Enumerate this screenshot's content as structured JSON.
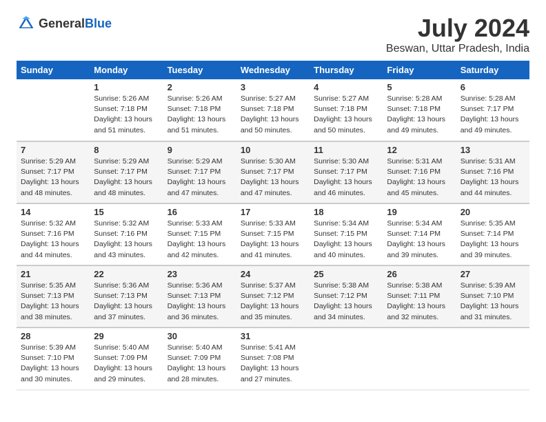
{
  "header": {
    "logo_general": "General",
    "logo_blue": "Blue",
    "title": "July 2024",
    "subtitle": "Beswan, Uttar Pradesh, India"
  },
  "columns": [
    "Sunday",
    "Monday",
    "Tuesday",
    "Wednesday",
    "Thursday",
    "Friday",
    "Saturday"
  ],
  "weeks": [
    {
      "days": [
        {
          "number": "",
          "lines": []
        },
        {
          "number": "1",
          "lines": [
            "Sunrise: 5:26 AM",
            "Sunset: 7:18 PM",
            "Daylight: 13 hours",
            "and 51 minutes."
          ]
        },
        {
          "number": "2",
          "lines": [
            "Sunrise: 5:26 AM",
            "Sunset: 7:18 PM",
            "Daylight: 13 hours",
            "and 51 minutes."
          ]
        },
        {
          "number": "3",
          "lines": [
            "Sunrise: 5:27 AM",
            "Sunset: 7:18 PM",
            "Daylight: 13 hours",
            "and 50 minutes."
          ]
        },
        {
          "number": "4",
          "lines": [
            "Sunrise: 5:27 AM",
            "Sunset: 7:18 PM",
            "Daylight: 13 hours",
            "and 50 minutes."
          ]
        },
        {
          "number": "5",
          "lines": [
            "Sunrise: 5:28 AM",
            "Sunset: 7:18 PM",
            "Daylight: 13 hours",
            "and 49 minutes."
          ]
        },
        {
          "number": "6",
          "lines": [
            "Sunrise: 5:28 AM",
            "Sunset: 7:17 PM",
            "Daylight: 13 hours",
            "and 49 minutes."
          ]
        }
      ]
    },
    {
      "days": [
        {
          "number": "7",
          "lines": [
            "Sunrise: 5:29 AM",
            "Sunset: 7:17 PM",
            "Daylight: 13 hours",
            "and 48 minutes."
          ]
        },
        {
          "number": "8",
          "lines": [
            "Sunrise: 5:29 AM",
            "Sunset: 7:17 PM",
            "Daylight: 13 hours",
            "and 48 minutes."
          ]
        },
        {
          "number": "9",
          "lines": [
            "Sunrise: 5:29 AM",
            "Sunset: 7:17 PM",
            "Daylight: 13 hours",
            "and 47 minutes."
          ]
        },
        {
          "number": "10",
          "lines": [
            "Sunrise: 5:30 AM",
            "Sunset: 7:17 PM",
            "Daylight: 13 hours",
            "and 47 minutes."
          ]
        },
        {
          "number": "11",
          "lines": [
            "Sunrise: 5:30 AM",
            "Sunset: 7:17 PM",
            "Daylight: 13 hours",
            "and 46 minutes."
          ]
        },
        {
          "number": "12",
          "lines": [
            "Sunrise: 5:31 AM",
            "Sunset: 7:16 PM",
            "Daylight: 13 hours",
            "and 45 minutes."
          ]
        },
        {
          "number": "13",
          "lines": [
            "Sunrise: 5:31 AM",
            "Sunset: 7:16 PM",
            "Daylight: 13 hours",
            "and 44 minutes."
          ]
        }
      ]
    },
    {
      "days": [
        {
          "number": "14",
          "lines": [
            "Sunrise: 5:32 AM",
            "Sunset: 7:16 PM",
            "Daylight: 13 hours",
            "and 44 minutes."
          ]
        },
        {
          "number": "15",
          "lines": [
            "Sunrise: 5:32 AM",
            "Sunset: 7:16 PM",
            "Daylight: 13 hours",
            "and 43 minutes."
          ]
        },
        {
          "number": "16",
          "lines": [
            "Sunrise: 5:33 AM",
            "Sunset: 7:15 PM",
            "Daylight: 13 hours",
            "and 42 minutes."
          ]
        },
        {
          "number": "17",
          "lines": [
            "Sunrise: 5:33 AM",
            "Sunset: 7:15 PM",
            "Daylight: 13 hours",
            "and 41 minutes."
          ]
        },
        {
          "number": "18",
          "lines": [
            "Sunrise: 5:34 AM",
            "Sunset: 7:15 PM",
            "Daylight: 13 hours",
            "and 40 minutes."
          ]
        },
        {
          "number": "19",
          "lines": [
            "Sunrise: 5:34 AM",
            "Sunset: 7:14 PM",
            "Daylight: 13 hours",
            "and 39 minutes."
          ]
        },
        {
          "number": "20",
          "lines": [
            "Sunrise: 5:35 AM",
            "Sunset: 7:14 PM",
            "Daylight: 13 hours",
            "and 39 minutes."
          ]
        }
      ]
    },
    {
      "days": [
        {
          "number": "21",
          "lines": [
            "Sunrise: 5:35 AM",
            "Sunset: 7:13 PM",
            "Daylight: 13 hours",
            "and 38 minutes."
          ]
        },
        {
          "number": "22",
          "lines": [
            "Sunrise: 5:36 AM",
            "Sunset: 7:13 PM",
            "Daylight: 13 hours",
            "and 37 minutes."
          ]
        },
        {
          "number": "23",
          "lines": [
            "Sunrise: 5:36 AM",
            "Sunset: 7:13 PM",
            "Daylight: 13 hours",
            "and 36 minutes."
          ]
        },
        {
          "number": "24",
          "lines": [
            "Sunrise: 5:37 AM",
            "Sunset: 7:12 PM",
            "Daylight: 13 hours",
            "and 35 minutes."
          ]
        },
        {
          "number": "25",
          "lines": [
            "Sunrise: 5:38 AM",
            "Sunset: 7:12 PM",
            "Daylight: 13 hours",
            "and 34 minutes."
          ]
        },
        {
          "number": "26",
          "lines": [
            "Sunrise: 5:38 AM",
            "Sunset: 7:11 PM",
            "Daylight: 13 hours",
            "and 32 minutes."
          ]
        },
        {
          "number": "27",
          "lines": [
            "Sunrise: 5:39 AM",
            "Sunset: 7:10 PM",
            "Daylight: 13 hours",
            "and 31 minutes."
          ]
        }
      ]
    },
    {
      "days": [
        {
          "number": "28",
          "lines": [
            "Sunrise: 5:39 AM",
            "Sunset: 7:10 PM",
            "Daylight: 13 hours",
            "and 30 minutes."
          ]
        },
        {
          "number": "29",
          "lines": [
            "Sunrise: 5:40 AM",
            "Sunset: 7:09 PM",
            "Daylight: 13 hours",
            "and 29 minutes."
          ]
        },
        {
          "number": "30",
          "lines": [
            "Sunrise: 5:40 AM",
            "Sunset: 7:09 PM",
            "Daylight: 13 hours",
            "and 28 minutes."
          ]
        },
        {
          "number": "31",
          "lines": [
            "Sunrise: 5:41 AM",
            "Sunset: 7:08 PM",
            "Daylight: 13 hours",
            "and 27 minutes."
          ]
        },
        {
          "number": "",
          "lines": []
        },
        {
          "number": "",
          "lines": []
        },
        {
          "number": "",
          "lines": []
        }
      ]
    }
  ]
}
